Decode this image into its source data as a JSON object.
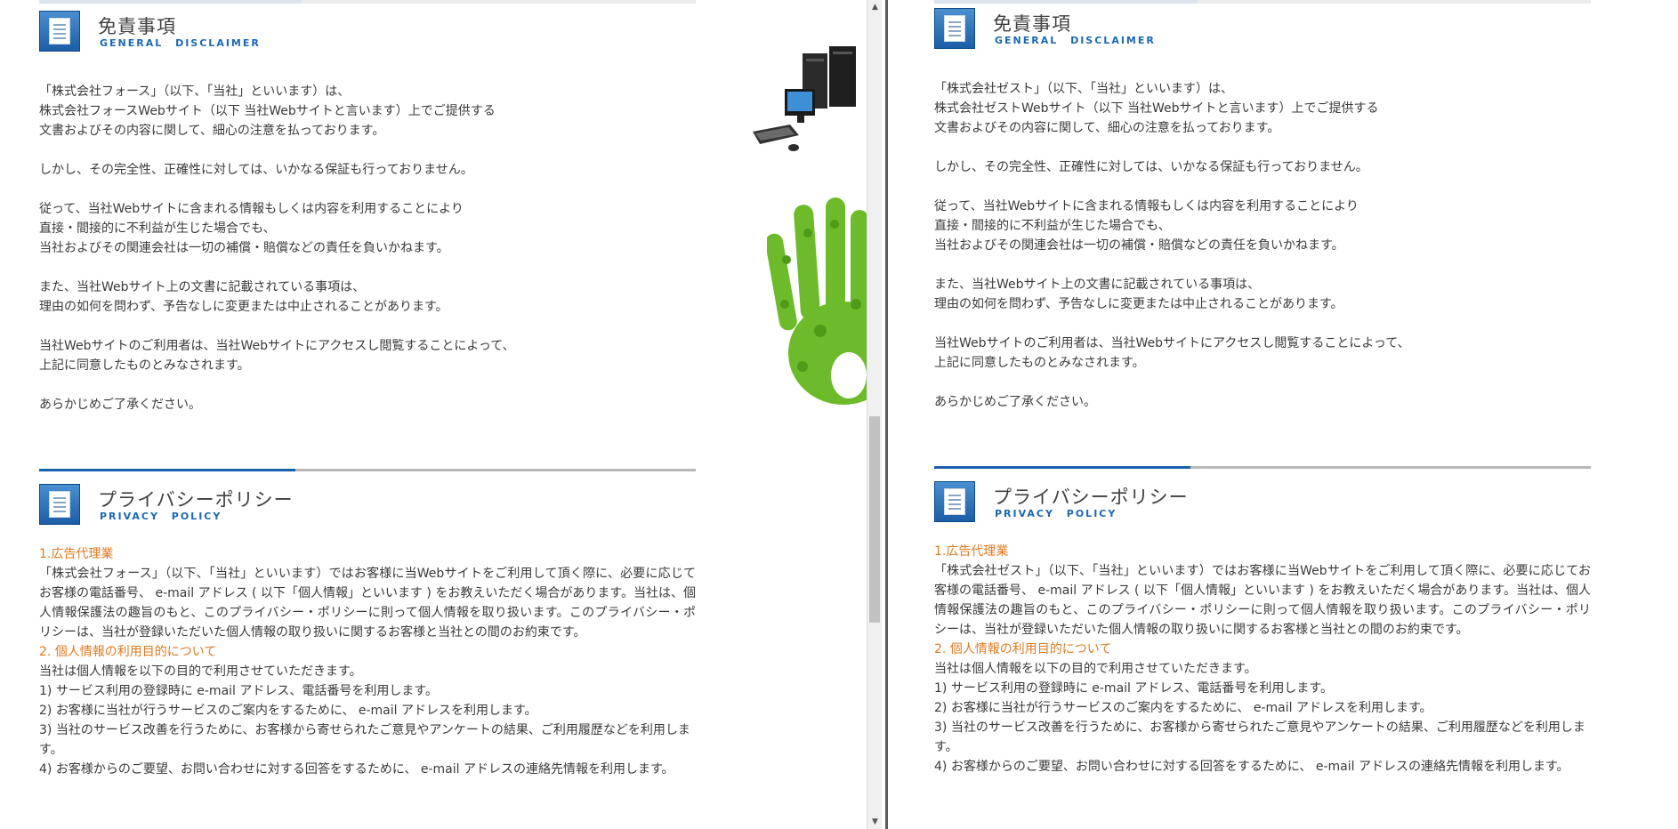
{
  "left": {
    "disclaimer": {
      "title": "免責事項",
      "subtitle": "GENERAL DISCLAIMER",
      "paragraphs": [
        "「株式会社フォース」（以下、「当社」といいます）は、\n株式会社フォースWebサイト（以下 当社Webサイトと言います）上でご提供する\n文書およびその内容に関して、細心の注意を払っております。",
        "しかし、その完全性、正確性に対しては、いかなる保証も行っておりません。",
        "従って、当社Webサイトに含まれる情報もしくは内容を利用することにより\n直接・間接的に不利益が生じた場合でも、\n当社およびその関連会社は一切の補償・賠償などの責任を負いかねます。",
        "また、当社Webサイト上の文書に記載されている事項は、\n理由の如何を問わず、予告なしに変更または中止されることがあります。",
        "当社Webサイトのご利用者は、当社Webサイトにアクセスし閲覧することによって、\n上記に同意したものとみなされます。",
        "あらかじめご了承ください。"
      ]
    },
    "privacy": {
      "title": "プライバシーポリシー",
      "subtitle": "PRIVACY POLICY",
      "s1_heading": "1.広告代理業",
      "s1_body": "「株式会社フォース」（以下、「当社」といいます）ではお客様に当Webサイトをご利用して頂く際に、必要に応じてお客様の電話番号、 e-mail アドレス ( 以下「個人情報」といいます ) をお教えいただく場合があります。当社は、個人情報保護法の趣旨のもと、このプライバシー・ポリシーに則って個人情報を取り扱います。このプライバシー・ポリシーは、当社が登録いただいた個人情報の取り扱いに関するお客様と当社との間のお約束です。",
      "s2_heading": "2. 個人情報の利用目的について",
      "s2_lines": [
        "当社は個人情報を以下の目的で利用させていただきます。",
        "1) サービス利用の登録時に e-mail アドレス、電話番号を利用します。",
        "2) お客様に当社が行うサービスのご案内をするために、 e-mail アドレスを利用します。",
        "3) 当社のサービス改善を行うために、お客様から寄せられたご意見やアンケートの結果、ご利用履歴などを利用します。",
        "4) お客様からのご要望、お問い合わせに対する回答をするために、 e-mail アドレスの連絡先情報を利用します。"
      ]
    }
  },
  "right": {
    "disclaimer": {
      "title": "免責事項",
      "subtitle": "GENERAL DISCLAIMER",
      "paragraphs": [
        "「株式会社ゼスト」（以下、「当社」といいます）は、\n株式会社ゼストWebサイト（以下 当社Webサイトと言います）上でご提供する\n文書およびその内容に関して、細心の注意を払っております。",
        "しかし、その完全性、正確性に対しては、いかなる保証も行っておりません。",
        "従って、当社Webサイトに含まれる情報もしくは内容を利用することにより\n直接・間接的に不利益が生じた場合でも、\n当社およびその関連会社は一切の補償・賠償などの責任を負いかねます。",
        "また、当社Webサイト上の文書に記載されている事項は、\n理由の如何を問わず、予告なしに変更または中止されることがあります。",
        "当社Webサイトのご利用者は、当社Webサイトにアクセスし閲覧することによって、\n上記に同意したものとみなされます。",
        "あらかじめご了承ください。"
      ]
    },
    "privacy": {
      "title": "プライバシーポリシー",
      "subtitle": "PRIVACY POLICY",
      "s1_heading": "1.広告代理業",
      "s1_body": "「株式会社ゼスト」（以下、「当社」といいます）ではお客様に当Webサイトをご利用して頂く際に、必要に応じてお客様の電話番号、 e-mail アドレス ( 以下「個人情報」といいます ) をお教えいただく場合があります。当社は、個人情報保護法の趣旨のもと、このプライバシー・ポリシーに則って個人情報を取り扱います。このプライバシー・ポリシーは、当社が登録いただいた個人情報の取り扱いに関するお客様と当社との間のお約束です。",
      "s2_heading": "2. 個人情報の利用目的について",
      "s2_lines": [
        "当社は個人情報を以下の目的で利用させていただきます。",
        "1) サービス利用の登録時に e-mail アドレス、電話番号を利用します。",
        "2) お客様に当社が行うサービスのご案内をするために、 e-mail アドレスを利用します。",
        "3) 当社のサービス改善を行うために、お客様から寄せられたご意見やアンケートの結果、ご利用履歴などを利用します。",
        "4) お客様からのご要望、お問い合わせに対する回答をするために、 e-mail アドレスの連絡先情報を利用します。"
      ]
    }
  },
  "icons": {
    "section_icon": "document-icon",
    "decor_top": "computer-illustration",
    "decor_bottom": "green-leaf-hand-illustration",
    "scroll_up": "scroll-up-arrow-icon",
    "scroll_down": "scroll-down-arrow-icon"
  }
}
